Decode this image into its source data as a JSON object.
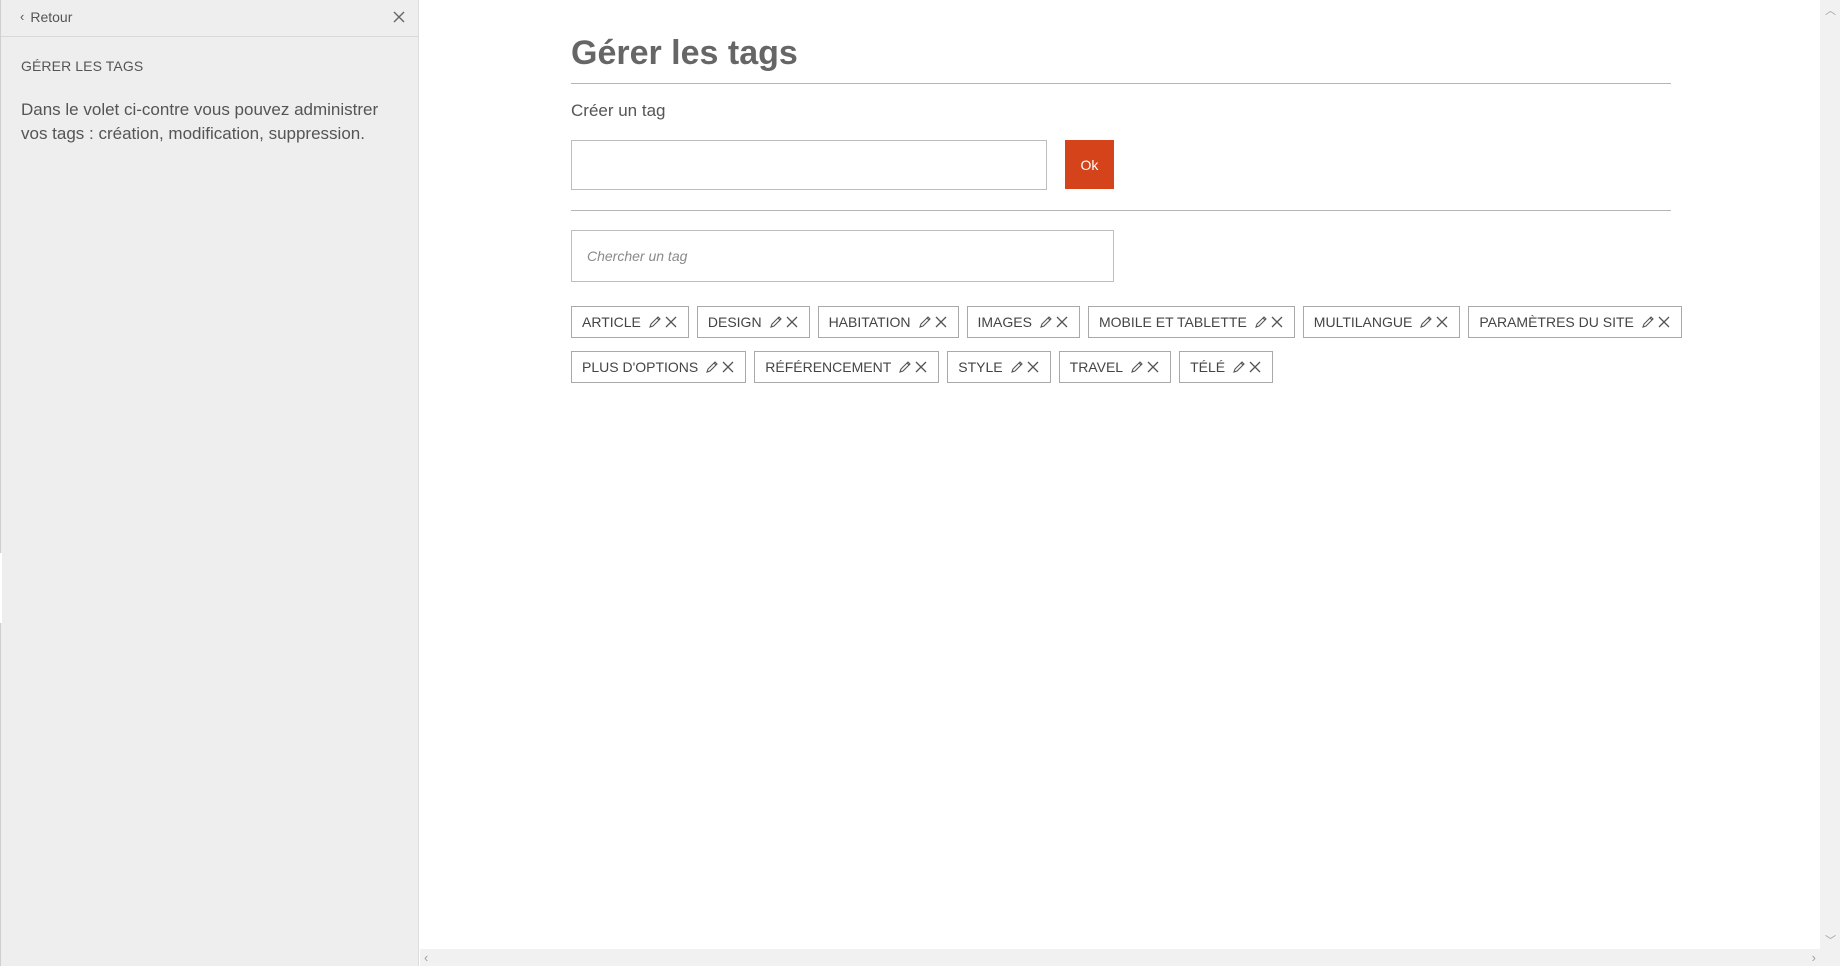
{
  "sidebar": {
    "back_label": "Retour",
    "title": "GÉRER LES TAGS",
    "description": "Dans le volet ci-contre vous pouvez administrer vos tags : création, modification, suppression."
  },
  "main": {
    "title": "Gérer les tags",
    "create_label": "Créer un tag",
    "create_value": "",
    "ok_label": "Ok",
    "search_placeholder": "Chercher un tag"
  },
  "tags_row1": [
    "ARTICLE",
    "DESIGN",
    "HABITATION",
    "IMAGES",
    "MOBILE ET TABLETTE",
    "MULTILANGUE",
    "PARAMÈTRES DU SITE"
  ],
  "tags_row2": [
    "PLUS D'OPTIONS",
    "RÉFÉRENCEMENT",
    "STYLE",
    "TRAVEL",
    "TÉLÉ"
  ],
  "colors": {
    "accent": "#d4431a",
    "sidebar_bg": "#eeeeee"
  },
  "icons": {
    "tag_edit": "pencil-icon",
    "tag_delete": "close-icon",
    "back": "chevron-left-icon"
  }
}
